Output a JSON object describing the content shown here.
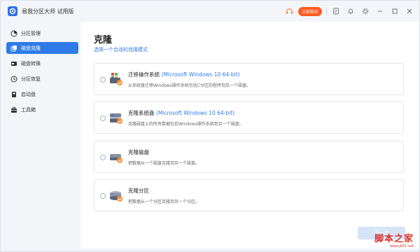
{
  "app": {
    "title": "易我分区大师 试用版"
  },
  "titlebar": {
    "headset_icon": "headset-icon",
    "buy_label": "立即购买",
    "icons": [
      "notes-icon",
      "bell-icon",
      "settings-icon",
      "minimize-icon",
      "maximize-icon",
      "close-icon"
    ]
  },
  "sidebar": {
    "items": [
      {
        "label": "分区管理",
        "icon": "partition-icon",
        "active": false
      },
      {
        "label": "磁盘克隆",
        "icon": "clone-icon",
        "active": true
      },
      {
        "label": "磁盘转换",
        "icon": "convert-icon",
        "active": false
      },
      {
        "label": "分区恢复",
        "icon": "recovery-icon",
        "active": false
      },
      {
        "label": "启动盘",
        "icon": "bootdisk-icon",
        "active": false
      },
      {
        "label": "工具箱",
        "icon": "toolbox-icon",
        "active": false
      }
    ]
  },
  "main": {
    "title": "克隆",
    "subtitle": "选择一个合适的克隆模式",
    "options": [
      {
        "title": "迁移操作系统 ",
        "accent": "(Microsoft Windows 10 64-bit)",
        "desc": "从系统盘迁移Windows操作系统包括C分区的程序到另一个磁盘。"
      },
      {
        "title": "克隆系统盘 ",
        "accent": "(Microsoft Windows 10 64-bit)",
        "desc": "克隆磁盘上的所有数据包括Windows操作系统到另一个磁盘。"
      },
      {
        "title": "克隆磁盘",
        "accent": "",
        "desc": "把数据从一个磁盘克隆到另一个磁盘。"
      },
      {
        "title": "克隆分区",
        "accent": "",
        "desc": "把数据从一个分区克隆到另一个分区。"
      }
    ],
    "next_label": "下一步"
  },
  "watermark": {
    "text": "脚本之家",
    "url": "www.jb51.net"
  },
  "colors": {
    "accent": "#2f7ce8",
    "buy": "#ff5a1f",
    "watermark": "#d9332b"
  }
}
